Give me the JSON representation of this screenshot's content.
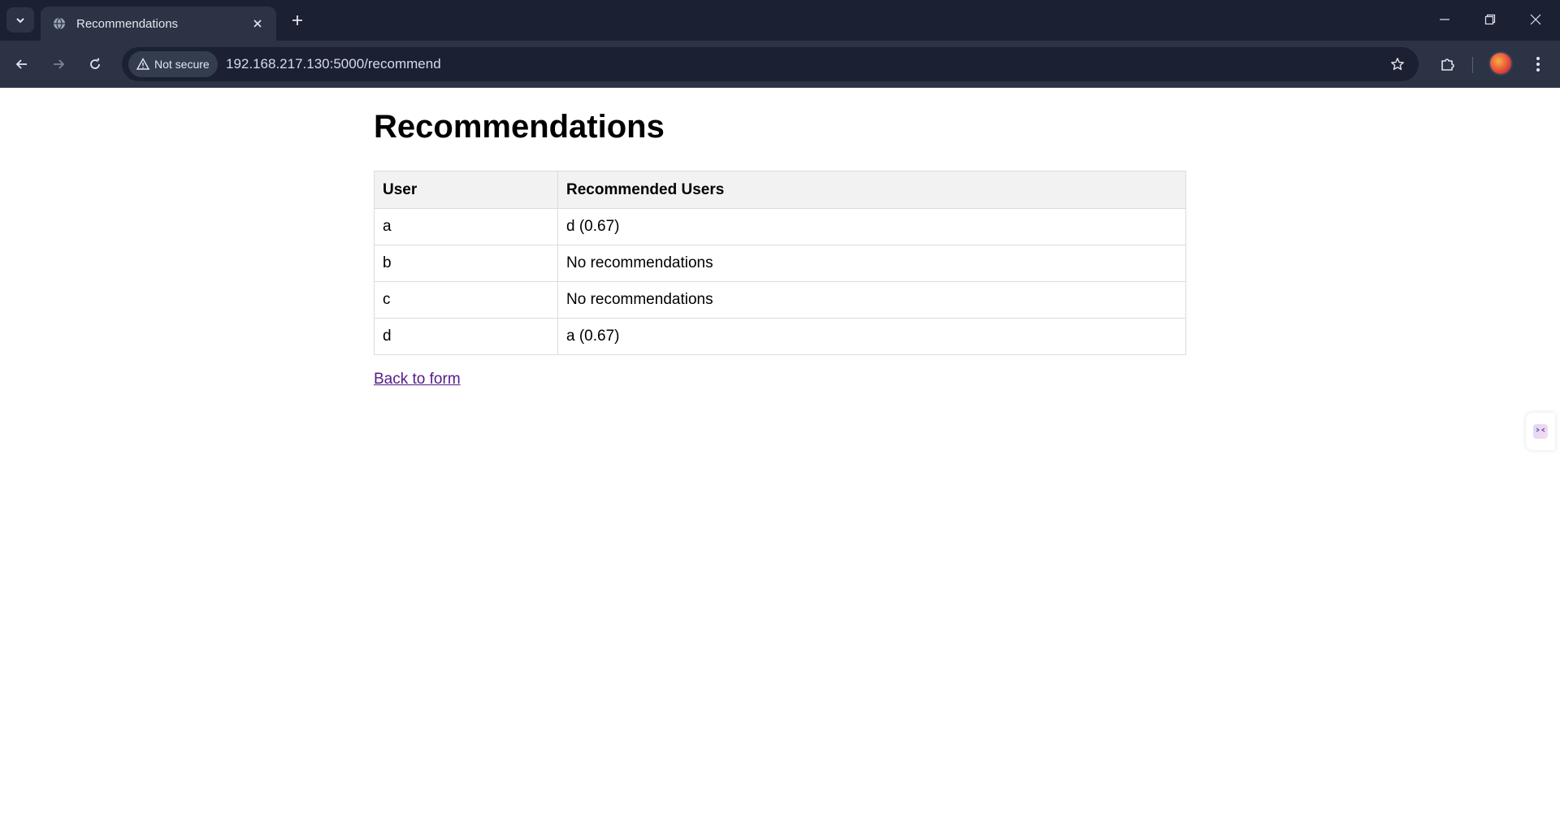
{
  "browser": {
    "tab_title": "Recommendations",
    "security_label": "Not secure",
    "url": "192.168.217.130:5000/recommend"
  },
  "icons": {
    "tab_search": "chevron-down-icon",
    "favicon": "globe-icon",
    "tab_close": "close-icon",
    "new_tab": "plus-icon",
    "back": "arrow-left-icon",
    "forward": "arrow-right-icon",
    "reload": "reload-icon",
    "warning": "warning-icon",
    "bookmark": "star-icon",
    "extensions": "puzzle-icon",
    "menu": "kebab-menu-icon",
    "side_widget": "sparkle-icon"
  },
  "page": {
    "title": "Recommendations",
    "table": {
      "headers": [
        "User",
        "Recommended Users"
      ],
      "rows": [
        [
          "a",
          "d (0.67)"
        ],
        [
          "b",
          "No recommendations"
        ],
        [
          "c",
          "No recommendations"
        ],
        [
          "d",
          "a (0.67)"
        ]
      ]
    },
    "back_link": "Back to form"
  }
}
